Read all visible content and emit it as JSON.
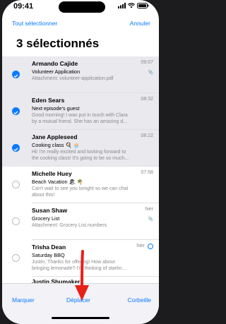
{
  "status_bar": {
    "time": "09:41"
  },
  "nav": {
    "select_all": "Tout sélectionner",
    "cancel": "Annuler"
  },
  "title": "3 sélectionnés",
  "messages": [
    {
      "sender": "Armando Cajide",
      "date": "09:07",
      "subject": "Volunteer Application",
      "preview": "Attachment: volunteer-application.pdf",
      "preview2": "",
      "selected": true,
      "attachment": true
    },
    {
      "sender": "Eden Sears",
      "date": "08:32",
      "subject": "Next episode's guest",
      "preview": "Good morning! I was put in touch with Clara",
      "preview2": "by a mutual friend. She has an amazing d...",
      "selected": true,
      "attachment": false
    },
    {
      "sender": "Jane Appleseed",
      "date": "08:22",
      "subject": "Cooking class 🍳 🧁",
      "preview": "Hi! I'm really excited and looking forward to",
      "preview2": "the cooking class! It's going to be so much...",
      "selected": true,
      "attachment": false
    },
    {
      "sender": "Michelle Huey",
      "date": "07:58",
      "subject": "Beach Vacation 🏖 🌴",
      "preview": "Can't wait to see you tonight so we can chat",
      "preview2": "about this!",
      "selected": false,
      "attachment": false
    },
    {
      "sender": "Susan Shaw",
      "date": "hier",
      "subject": "Grocery List",
      "preview": "Attachment: Grocery List.numbers",
      "preview2": "",
      "selected": false,
      "attachment": true
    },
    {
      "sender": "Trisha Dean",
      "date": "hier",
      "subject": "Saturday BBQ",
      "preview": "Justin, Thanks for offering! How about",
      "preview2": "bringing lemonade? I'm thinking of startin...",
      "selected": false,
      "attachment": false
    },
    {
      "sender": "Justin Shumaker",
      "date": "",
      "subject": "",
      "preview": "",
      "preview2": "",
      "selected": false,
      "attachment": false
    }
  ],
  "toolbar": {
    "mark": "Marquer",
    "move": "Déplacer",
    "trash": "Corbeille"
  },
  "colors": {
    "accent": "#0a7aff",
    "annotation_arrow": "#e8201a",
    "selected_row": "#e9e9ee"
  },
  "icons": [
    "signal-icon",
    "wifi-icon",
    "battery-icon",
    "checkmark-icon",
    "paperclip-icon",
    "info-chevron-icon"
  ]
}
